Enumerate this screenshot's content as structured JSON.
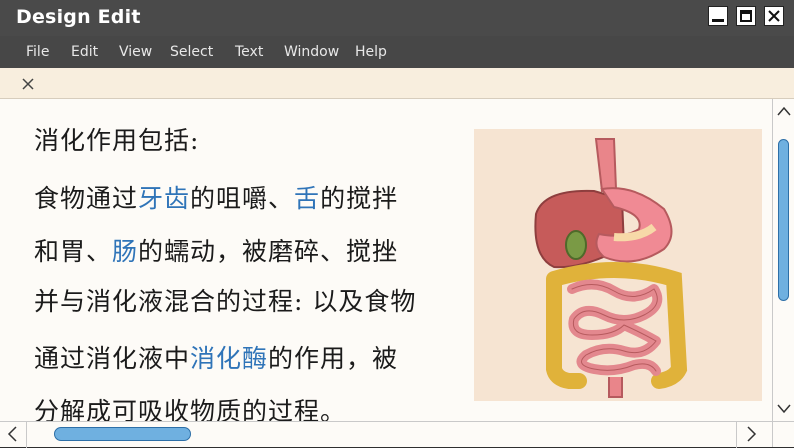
{
  "window": {
    "title": "Design Edit"
  },
  "menu": {
    "file": "File",
    "edit": "Edit",
    "view": "View",
    "select": "Select",
    "text": "Text",
    "window": "Window",
    "help": "Help"
  },
  "colors": {
    "titlebar": "#4a4a4a",
    "menubar": "#474747",
    "tabbar": "#f8eede",
    "content_bg": "#fdfbf7",
    "highlight_text": "#2f74b8",
    "scroll_thumb": "#6fb0e0"
  },
  "icons": {
    "tab_close": "close-icon",
    "minimize": "minimize-icon",
    "maximize": "maximize-icon",
    "close": "close-icon",
    "scroll_up": "arrow-up-icon",
    "scroll_down": "arrow-down-icon",
    "scroll_left": "arrow-left-icon",
    "scroll_right": "arrow-right-icon"
  },
  "content": {
    "heading": "消化作用包括:",
    "l1_a": "食物通过",
    "l1_b": "牙齿",
    "l1_c": "的咀嚼、",
    "l1_d": "舌",
    "l1_e": "的搅拌",
    "l2_a": "和胃、",
    "l2_b": "肠",
    "l2_c": "的蠕动，被磨碎、搅挫",
    "l3": "并与消化液混合的过程: 以及食物",
    "l4_a": "通过消化液中",
    "l4_b": "消化酶",
    "l4_c": "的作用，被",
    "l5": "分解成可吸收物质的过程。"
  }
}
